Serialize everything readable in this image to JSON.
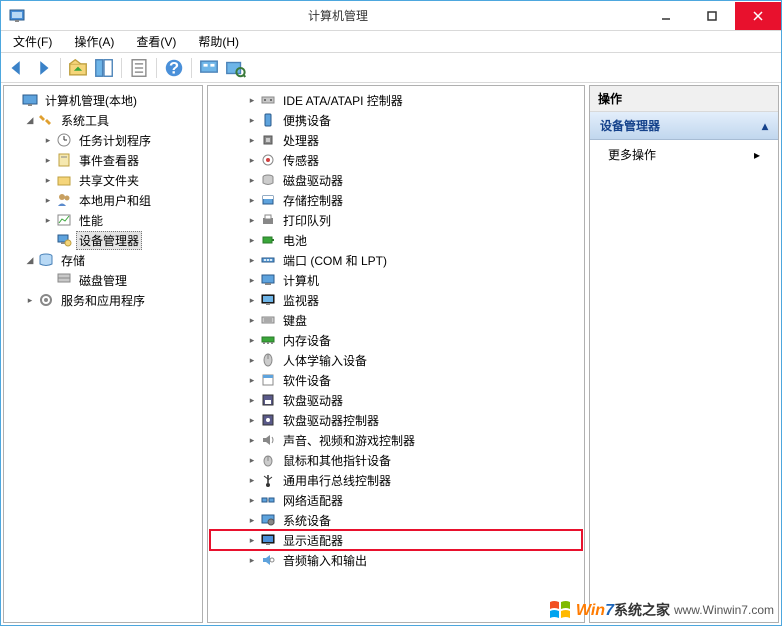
{
  "window": {
    "title": "计算机管理"
  },
  "menu": {
    "file": "文件(F)",
    "action": "操作(A)",
    "view": "查看(V)",
    "help": "帮助(H)"
  },
  "left_tree": {
    "root": "计算机管理(本地)",
    "items": [
      {
        "label": "系统工具",
        "expanded": true,
        "children": [
          {
            "label": "任务计划程序"
          },
          {
            "label": "事件查看器"
          },
          {
            "label": "共享文件夹"
          },
          {
            "label": "本地用户和组"
          },
          {
            "label": "性能"
          },
          {
            "label": "设备管理器",
            "selected": true
          }
        ]
      },
      {
        "label": "存储",
        "expanded": true,
        "children": [
          {
            "label": "磁盘管理"
          }
        ]
      },
      {
        "label": "服务和应用程序"
      }
    ]
  },
  "device_tree": [
    {
      "label": "IDE ATA/ATAPI 控制器",
      "icon": "controller-icon"
    },
    {
      "label": "便携设备",
      "icon": "portable-icon"
    },
    {
      "label": "处理器",
      "icon": "cpu-icon"
    },
    {
      "label": "传感器",
      "icon": "sensor-icon"
    },
    {
      "label": "磁盘驱动器",
      "icon": "disk-icon"
    },
    {
      "label": "存储控制器",
      "icon": "storage-icon"
    },
    {
      "label": "打印队列",
      "icon": "printer-icon"
    },
    {
      "label": "电池",
      "icon": "battery-icon"
    },
    {
      "label": "端口 (COM 和 LPT)",
      "icon": "port-icon"
    },
    {
      "label": "计算机",
      "icon": "computer-icon"
    },
    {
      "label": "监视器",
      "icon": "monitor-icon"
    },
    {
      "label": "键盘",
      "icon": "keyboard-icon"
    },
    {
      "label": "内存设备",
      "icon": "memory-icon"
    },
    {
      "label": "人体学输入设备",
      "icon": "hid-icon"
    },
    {
      "label": "软件设备",
      "icon": "software-icon"
    },
    {
      "label": "软盘驱动器",
      "icon": "floppy-icon"
    },
    {
      "label": "软盘驱动器控制器",
      "icon": "floppy-ctrl-icon"
    },
    {
      "label": "声音、视频和游戏控制器",
      "icon": "sound-icon"
    },
    {
      "label": "鼠标和其他指针设备",
      "icon": "mouse-icon"
    },
    {
      "label": "通用串行总线控制器",
      "icon": "usb-icon"
    },
    {
      "label": "网络适配器",
      "icon": "network-icon"
    },
    {
      "label": "系统设备",
      "icon": "system-icon"
    },
    {
      "label": "显示适配器",
      "icon": "display-icon",
      "highlight": true
    },
    {
      "label": "音频输入和输出",
      "icon": "audio-icon"
    }
  ],
  "actions": {
    "header": "操作",
    "section": "设备管理器",
    "more": "更多操作"
  },
  "watermark": {
    "brand1": "Win",
    "brand2": "7",
    "brand3": "系统之家",
    "url": "www.Winwin7.com"
  }
}
